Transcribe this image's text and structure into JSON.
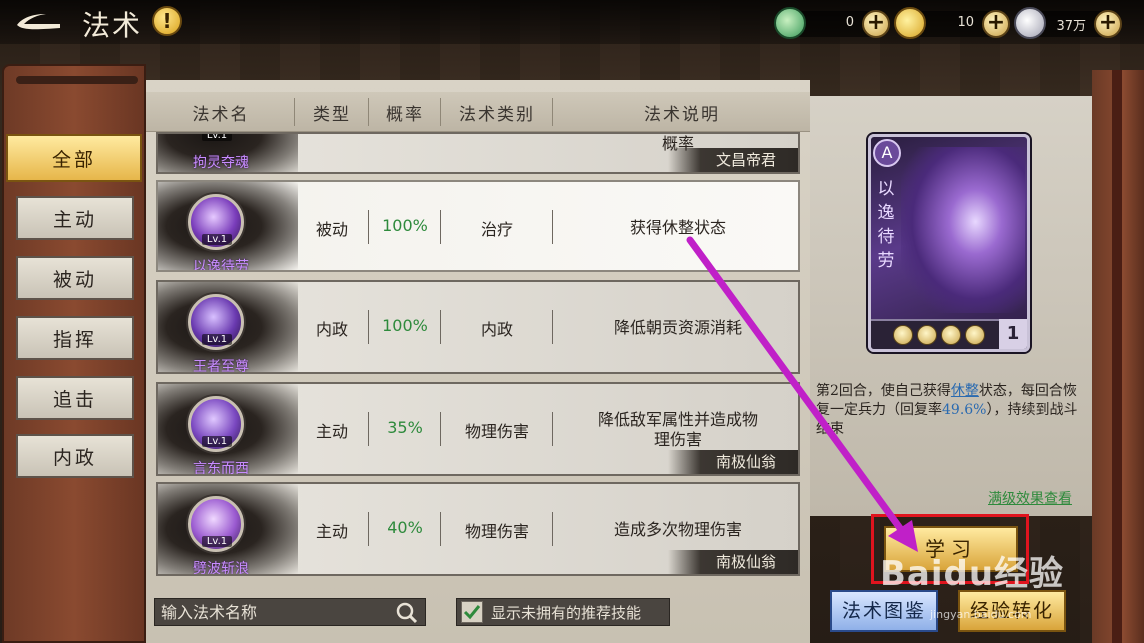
{
  "header": {
    "title": "法术",
    "help_badge": "!",
    "currencies": [
      {
        "name": "jade-icon",
        "value": "0"
      },
      {
        "name": "gold-coin-icon",
        "value": "10"
      },
      {
        "name": "silver-icon",
        "value": "37万"
      }
    ],
    "plus": "+"
  },
  "sidebar": {
    "items": [
      {
        "label": "全部",
        "active": true
      },
      {
        "label": "主动",
        "active": false
      },
      {
        "label": "被动",
        "active": false
      },
      {
        "label": "指挥",
        "active": false
      },
      {
        "label": "追击",
        "active": false
      },
      {
        "label": "内政",
        "active": false
      }
    ]
  },
  "table": {
    "columns": [
      "法术名",
      "类型",
      "概率",
      "法术类别",
      "法术说明"
    ],
    "partial_row": {
      "name": "拘灵夺魂",
      "level": "Lv.1",
      "desc_tail": "概率",
      "source": "文昌帝君"
    },
    "rows": [
      {
        "name": "以逸待劳",
        "level": "Lv.1",
        "type": "被动",
        "rate": "100%",
        "category": "治疗",
        "desc": "获得休整状态",
        "source": "",
        "selected": true
      },
      {
        "name": "王者至尊",
        "level": "Lv.1",
        "type": "内政",
        "rate": "100%",
        "category": "内政",
        "desc": "降低朝贡资源消耗",
        "source": "",
        "selected": false
      },
      {
        "name": "言东而西",
        "level": "Lv.1",
        "type": "主动",
        "rate": "35%",
        "category": "物理伤害",
        "desc": "降低敌军属性并造成物理伤害",
        "source": "南极仙翁",
        "selected": false
      },
      {
        "name": "劈波斩浪",
        "level": "Lv.1",
        "type": "主动",
        "rate": "40%",
        "category": "物理伤害",
        "desc": "造成多次物理伤害",
        "source": "南极仙翁",
        "selected": false
      }
    ]
  },
  "footer": {
    "search_placeholder": "输入法术名称",
    "show_unowned_label": "显示未拥有的推荐技能",
    "show_unowned_checked": true
  },
  "detail": {
    "grade": "A",
    "card_name": "以逸待劳",
    "card_count": "1",
    "effect_part1": "第2回合，使自己获得",
    "effect_keyword": "休整",
    "effect_part2": "状态，每回合恢复一定兵力（回复率",
    "effect_pct": "49.6%",
    "effect_part3": "），持续到战斗结束",
    "max_effect_link": "满级效果查看",
    "learn_button": "学习",
    "codex_button": "法术图鉴",
    "convert_button": "经验转化"
  },
  "watermark": {
    "brand": "Baidu经验",
    "url": "jingyan.baidu.com"
  },
  "colors": {
    "rate_green": "#2e8a3c",
    "highlight_red": "#e0141e",
    "arrow_magenta": "#c020c8",
    "skill_name_purple": "#c88cff"
  }
}
